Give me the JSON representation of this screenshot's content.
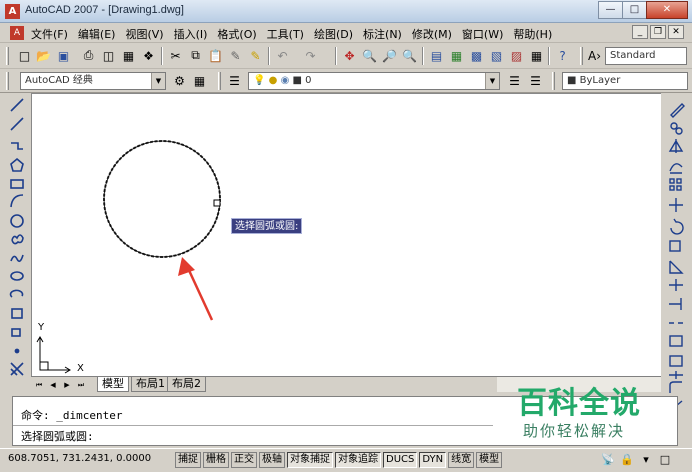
{
  "window": {
    "title": "AutoCAD 2007 - [Drawing1.dwg]",
    "buttons": [
      "minimize",
      "maximize",
      "close"
    ]
  },
  "menubar": {
    "items": [
      "文件(F)",
      "编辑(E)",
      "视图(V)",
      "插入(I)",
      "格式(O)",
      "工具(T)",
      "绘图(D)",
      "标注(N)",
      "修改(M)",
      "窗口(W)",
      "帮助(H)"
    ],
    "mdi_buttons": [
      "minimize",
      "restore",
      "close"
    ]
  },
  "toolbar_standard": {
    "text_style": "Standard"
  },
  "toolbar_workspace": {
    "workspace": "AutoCAD 经典",
    "layer": "0",
    "color": "ByLayer"
  },
  "canvas": {
    "tooltip": "选择圆弧或圆:",
    "ucs": {
      "x_label": "X",
      "y_label": "Y"
    }
  },
  "layout_tabs": {
    "tabs": [
      "模型",
      "布局1",
      "布局2"
    ],
    "active": "模型"
  },
  "command_window": {
    "history_line": "命令: _dimcenter",
    "prompt_line": "选择圆弧或圆:"
  },
  "statusbar": {
    "coordinates": "608.7051, 731.2431, 0.0000",
    "toggles": [
      "捕捉",
      "栅格",
      "正交",
      "极轴",
      "对象捕捉",
      "对象追踪",
      "DUCS",
      "DYN",
      "线宽",
      "模型"
    ]
  },
  "watermark": {
    "title": "百科全说",
    "subtitle": "助你轻松解决"
  },
  "colors": {
    "annotation_arrow": "#e23b2e",
    "tooltip_bg": "#3a3f80",
    "watermark_green": "#23a96a"
  }
}
